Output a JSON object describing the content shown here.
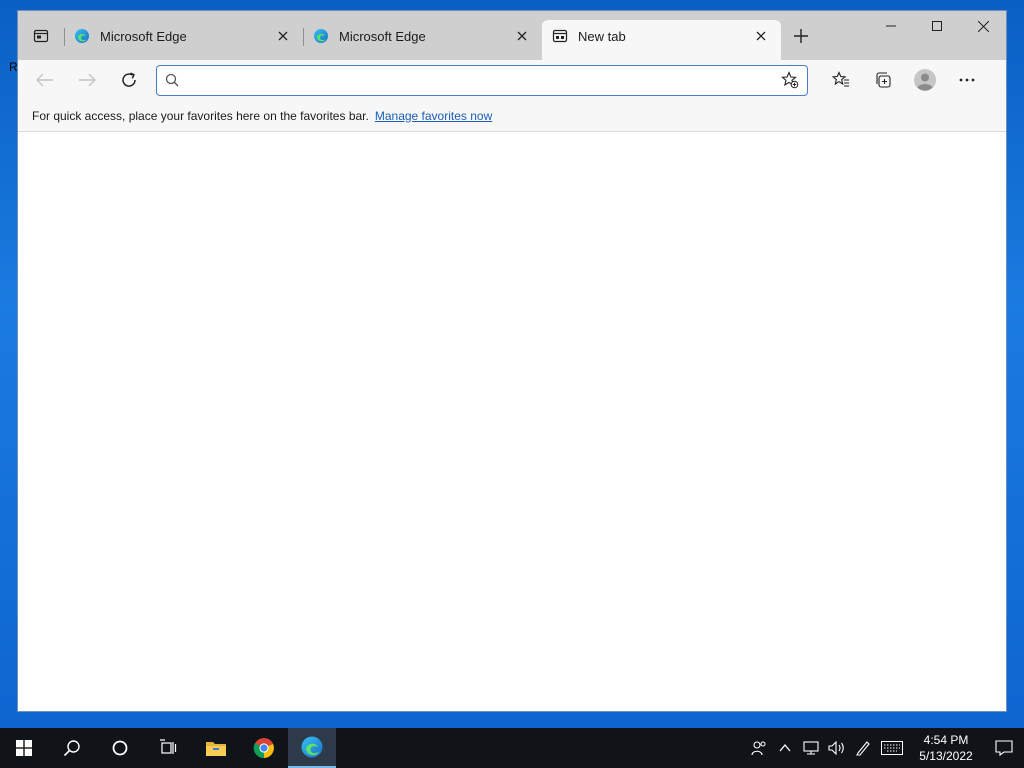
{
  "desktop": {
    "edge_glyph": "R"
  },
  "browser": {
    "tabs": [
      {
        "title": "Microsoft Edge",
        "icon": "edge-icon",
        "active": false
      },
      {
        "title": "Microsoft Edge",
        "icon": "edge-icon",
        "active": false
      },
      {
        "title": "New tab",
        "icon": "newtab-page-icon",
        "active": true
      }
    ],
    "address": {
      "value": "",
      "placeholder": ""
    },
    "favorites_bar": {
      "message": "For quick access, place your favorites here on the favorites bar.",
      "link": "Manage favorites now"
    }
  },
  "taskbar": {
    "time": "4:54 PM",
    "date": "5/13/2022"
  },
  "colors": {
    "accent": "#4a7ec4",
    "link": "#1a5fb4",
    "taskbar": "#101418",
    "desktop": "#0d63cf"
  }
}
